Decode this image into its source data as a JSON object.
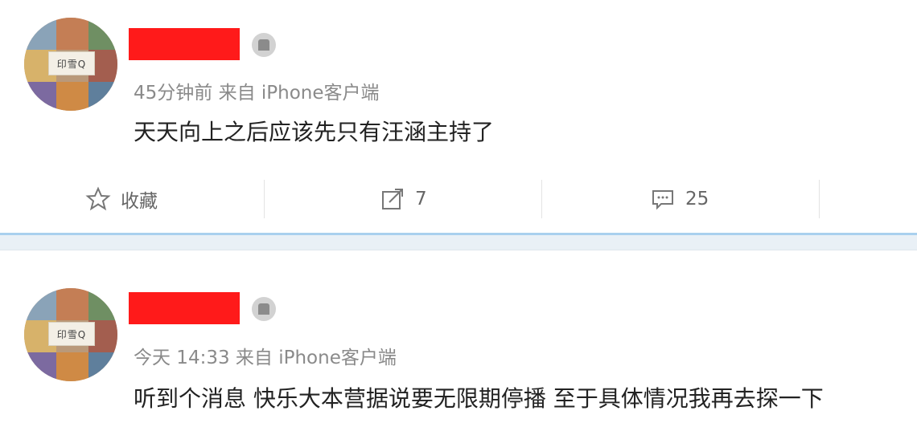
{
  "posts": [
    {
      "meta": "45分钟前 来自 iPhone客户端",
      "content": "天天向上之后应该先只有汪涵主持了",
      "avatar_badge": "印雪Q",
      "actions": {
        "favorite_label": "收藏",
        "repost_count": "7",
        "comment_count": "25"
      }
    },
    {
      "meta": "今天 14:33 来自 iPhone客户端",
      "content": "听到个消息 快乐大本营据说要无限期停播 至于具体情况我再去探一下",
      "avatar_badge": "印雪Q"
    }
  ],
  "icons": {
    "favorite": "star-outline-icon",
    "repost": "share-arrow-icon",
    "comment": "speech-bubble-icon",
    "vip": "vip-badge-icon"
  },
  "colors": {
    "redaction": "#ff1a1a",
    "separator": "#a9d0ee",
    "meta_text": "#8a8a8a"
  }
}
